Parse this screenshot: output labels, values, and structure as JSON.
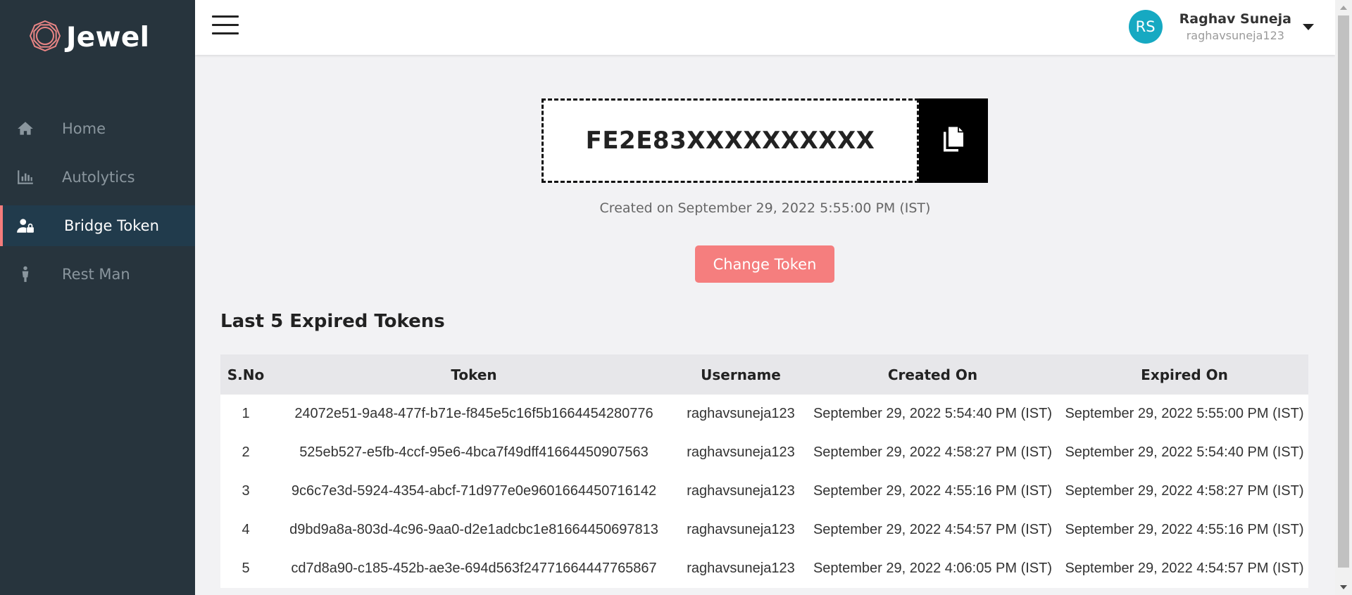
{
  "app": {
    "name": "Jewel"
  },
  "sidebar": {
    "items": [
      {
        "label": "Home",
        "icon": "home-icon",
        "active": false
      },
      {
        "label": "Autolytics",
        "icon": "bar-chart-icon",
        "active": false
      },
      {
        "label": "Bridge Token",
        "icon": "user-lock-icon",
        "active": true
      },
      {
        "label": "Rest Man",
        "icon": "person-icon",
        "active": false
      }
    ]
  },
  "header": {
    "user": {
      "initials": "RS",
      "name": "Raghav Suneja",
      "handle": "raghavsuneja123"
    }
  },
  "token": {
    "value": "FE2E83XXXXXXXXXX",
    "created_text": "Created on September 29, 2022 5:55:00 PM (IST)",
    "change_label": "Change Token"
  },
  "expired": {
    "title": "Last 5 Expired Tokens",
    "columns": [
      "S.No",
      "Token",
      "Username",
      "Created On",
      "Expired On"
    ],
    "rows": [
      {
        "sno": "1",
        "token": "24072e51-9a48-477f-b71e-f845e5c16f5b1664454280776",
        "username": "raghavsuneja123",
        "created": "September 29, 2022 5:54:40 PM (IST)",
        "expired": "September 29, 2022 5:55:00 PM (IST)"
      },
      {
        "sno": "2",
        "token": "525eb527-e5fb-4ccf-95e6-4bca7f49dff41664450907563",
        "username": "raghavsuneja123",
        "created": "September 29, 2022 4:58:27 PM (IST)",
        "expired": "September 29, 2022 5:54:40 PM (IST)"
      },
      {
        "sno": "3",
        "token": "9c6c7e3d-5924-4354-abcf-71d977e0e9601664450716142",
        "username": "raghavsuneja123",
        "created": "September 29, 2022 4:55:16 PM (IST)",
        "expired": "September 29, 2022 4:58:27 PM (IST)"
      },
      {
        "sno": "4",
        "token": "d9bd9a8a-803d-4c96-9aa0-d2e1adcbc1e81664450697813",
        "username": "raghavsuneja123",
        "created": "September 29, 2022 4:54:57 PM (IST)",
        "expired": "September 29, 2022 4:55:16 PM (IST)"
      },
      {
        "sno": "5",
        "token": "cd7d8a90-c185-452b-ae3e-694d563f24771664447765867",
        "username": "raghavsuneja123",
        "created": "September 29, 2022 4:06:05 PM (IST)",
        "expired": "September 29, 2022 4:54:57 PM (IST)"
      }
    ]
  },
  "colors": {
    "sidebar_bg": "#27343d",
    "active_item_bg": "#213b4c",
    "accent": "#f57e7e",
    "avatar_bg": "#16a9c2"
  }
}
